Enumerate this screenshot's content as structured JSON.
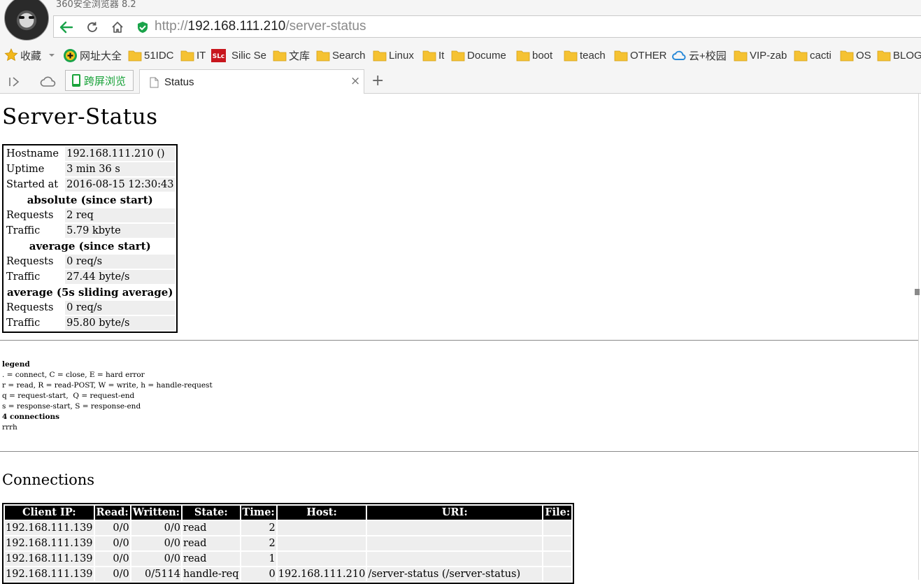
{
  "window": {
    "title": "360安全浏览器 8.2"
  },
  "address_bar": {
    "scheme": "http://",
    "host": "192.168.111.210",
    "path": "/server-status"
  },
  "bookmarks": [
    {
      "label": "收藏",
      "icon": "star-icon"
    },
    {
      "label": "网址大全",
      "icon": "plus-circle-icon"
    },
    {
      "label": "51IDC",
      "icon": "folder-icon"
    },
    {
      "label": "IT",
      "icon": "folder-icon"
    },
    {
      "label": "Silic Se",
      "icon": "silic-logo-icon"
    },
    {
      "label": "文库",
      "icon": "folder-icon"
    },
    {
      "label": "Search",
      "icon": "folder-icon"
    },
    {
      "label": "Linux",
      "icon": "folder-icon"
    },
    {
      "label": "It",
      "icon": "folder-icon"
    },
    {
      "label": "Docume",
      "icon": "folder-icon"
    },
    {
      "label": "boot",
      "icon": "folder-icon"
    },
    {
      "label": "teach",
      "icon": "folder-icon"
    },
    {
      "label": "OTHER",
      "icon": "folder-icon"
    },
    {
      "label": "云+校园",
      "icon": "cloud-icon"
    },
    {
      "label": "VIP-zab",
      "icon": "folder-icon"
    },
    {
      "label": "cacti",
      "icon": "folder-icon"
    },
    {
      "label": "OS",
      "icon": "folder-icon"
    },
    {
      "label": "BLOG",
      "icon": "folder-icon"
    }
  ],
  "tabs": {
    "cross_screen_label": "跨屏浏览",
    "active_tab_label": "Status",
    "close_symbol": "×",
    "new_tab_symbol": "+"
  },
  "colors": {
    "address_host": "#222222",
    "address_dim": "#8a8a8a",
    "cross_screen_green": "#19a33a",
    "folder_yellow": "#f5c232"
  },
  "page": {
    "title": "Server-Status",
    "status": {
      "hostname_label": "Hostname",
      "hostname_value": "192.168.111.210 ()",
      "uptime_label": "Uptime",
      "uptime_value": "3 min 36 s",
      "started_label": "Started at",
      "started_value": "2016-08-15 12:30:43",
      "absolute_header": "absolute (since start)",
      "abs_requests_label": "Requests",
      "abs_requests_value": "2 req",
      "abs_traffic_label": "Traffic",
      "abs_traffic_value": "5.79 kbyte",
      "average_header": "average (since start)",
      "avg_requests_label": "Requests",
      "avg_requests_value": "0 req/s",
      "avg_traffic_label": "Traffic",
      "avg_traffic_value": "27.44 byte/s",
      "sliding_header": "average (5s sliding average)",
      "sl_requests_label": "Requests",
      "sl_requests_value": "0 req/s",
      "sl_traffic_label": "Traffic",
      "sl_traffic_value": "95.80 byte/s"
    },
    "legend": {
      "title": "legend",
      "lines": [
        ". = connect, C = close, E = hard error",
        "r = read, R = read-POST, W = write, h = handle-request",
        "q = request-start,  Q = request-end",
        "s = response-start, S = response-end"
      ],
      "connections_count": "4 connections",
      "state_string": "rrrh"
    },
    "connections": {
      "title": "Connections",
      "headers": [
        "Client IP:",
        "Read:",
        "Written:",
        "State:",
        "Time:",
        "Host:",
        "URI:",
        "File:"
      ],
      "rows": [
        [
          "192.168.111.139",
          "0/0",
          "0/0",
          "read",
          "2",
          "",
          "",
          ""
        ],
        [
          "192.168.111.139",
          "0/0",
          "0/0",
          "read",
          "2",
          "",
          "",
          ""
        ],
        [
          "192.168.111.139",
          "0/0",
          "0/0",
          "read",
          "1",
          "",
          "",
          ""
        ],
        [
          "192.168.111.139",
          "0/0",
          "0/5114",
          "handle-req",
          "0",
          "192.168.111.210",
          "/server-status (/server-status)",
          ""
        ]
      ]
    }
  }
}
